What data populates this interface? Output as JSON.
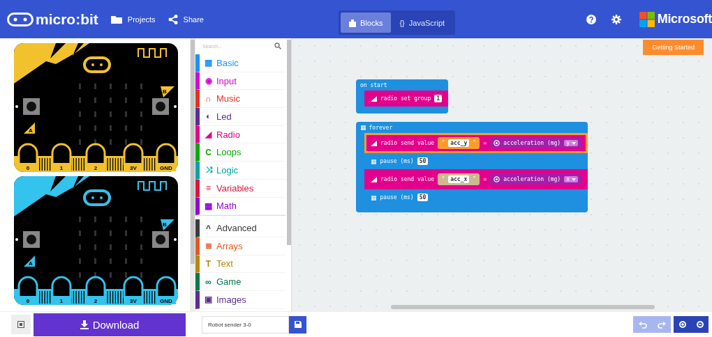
{
  "header": {
    "brand": "micro:bit",
    "actions": [
      {
        "kind": "folder",
        "label": "Projects"
      },
      {
        "kind": "share",
        "label": "Share"
      }
    ],
    "tabs": [
      {
        "kind": "puzzle",
        "label": "Blocks",
        "selected": true
      },
      {
        "kind": "code",
        "icon": "{}",
        "label": "JavaScript",
        "selected": false
      }
    ],
    "right_icons": [
      {
        "kind": "help"
      },
      {
        "kind": "settings"
      }
    ],
    "company": "Microsoft"
  },
  "simulator": {
    "boards": [
      {
        "color": "#f2c12e",
        "button_labels": [
          "A",
          "B"
        ],
        "pins": [
          "0",
          "1",
          "2",
          "3V",
          "GND"
        ]
      },
      {
        "color": "#33c3ec",
        "button_labels": [
          "A",
          "B"
        ],
        "pins": [
          "0",
          "1",
          "2",
          "3V",
          "GND"
        ]
      }
    ]
  },
  "toolbox": {
    "search": {
      "placeholder": "Search..."
    },
    "categories": [
      {
        "icon": "▦",
        "label": "Basic",
        "color": "#1e90ff"
      },
      {
        "icon": "◉",
        "label": "Input",
        "color": "#d400d4"
      },
      {
        "icon": "∩",
        "label": "Music",
        "color": "#e63022"
      },
      {
        "icon": "◐",
        "label": "Led",
        "color": "#5c2d91"
      },
      {
        "icon": "◢",
        "label": "Radio",
        "color": "#e3008c"
      },
      {
        "icon": "C",
        "label": "Loops",
        "color": "#00aa00"
      },
      {
        "icon": "⤨",
        "label": "Logic",
        "color": "#00a4a6"
      },
      {
        "icon": "≡",
        "label": "Variables",
        "color": "#dc143c"
      },
      {
        "icon": "▦",
        "label": "Math",
        "color": "#9400d3"
      }
    ],
    "advanced": [
      {
        "icon": "^",
        "label": "Advanced",
        "color": "#3c3c3c"
      },
      {
        "icon": "≣",
        "label": "Arrays",
        "color": "#e65722"
      },
      {
        "icon": "T",
        "label": "Text",
        "color": "#b8860b"
      },
      {
        "icon": "∞",
        "label": "Game",
        "color": "#007a4b"
      },
      {
        "icon": "▣",
        "label": "Images",
        "color": "#5c2d91"
      }
    ]
  },
  "workspace": {
    "getting_started": "Getting Started",
    "events": [
      {
        "kind": "plain",
        "title": "on start",
        "statements": [
          {
            "kind": "radio",
            "selected": false,
            "parts": [
              {
                "kind": "label",
                "text": "radio set group"
              },
              {
                "kind": "number",
                "text": "1"
              }
            ]
          }
        ]
      },
      {
        "kind": "loop",
        "title": "forever",
        "statements": [
          {
            "kind": "radio",
            "selected": true,
            "parts": [
              {
                "kind": "label",
                "text": "radio send value"
              },
              {
                "kind": "string",
                "open": "“",
                "text": "acc_y",
                "close": "”"
              },
              {
                "kind": "label",
                "text": "="
              },
              {
                "kind": "reporter",
                "text": "acceleration (mg)",
                "option": "y"
              }
            ]
          },
          {
            "kind": "basic",
            "selected": false,
            "parts": [
              {
                "kind": "label",
                "text": "pause (ms)"
              },
              {
                "kind": "number",
                "text": "50"
              }
            ]
          },
          {
            "kind": "radio",
            "selected": false,
            "parts": [
              {
                "kind": "label",
                "text": "radio send value"
              },
              {
                "kind": "string",
                "open": "“",
                "text": "acc_x",
                "close": "”"
              },
              {
                "kind": "label",
                "text": "="
              },
              {
                "kind": "reporter",
                "text": "acceleration (mg)",
                "option": "x"
              }
            ]
          },
          {
            "kind": "basic",
            "selected": false,
            "parts": [
              {
                "kind": "label",
                "text": "pause (ms)"
              },
              {
                "kind": "number",
                "text": "50"
              }
            ]
          }
        ]
      }
    ]
  },
  "footer": {
    "download": "Download",
    "project_name": "Robot sender 3-0",
    "undo_enabled": false,
    "redo_enabled": false
  }
}
